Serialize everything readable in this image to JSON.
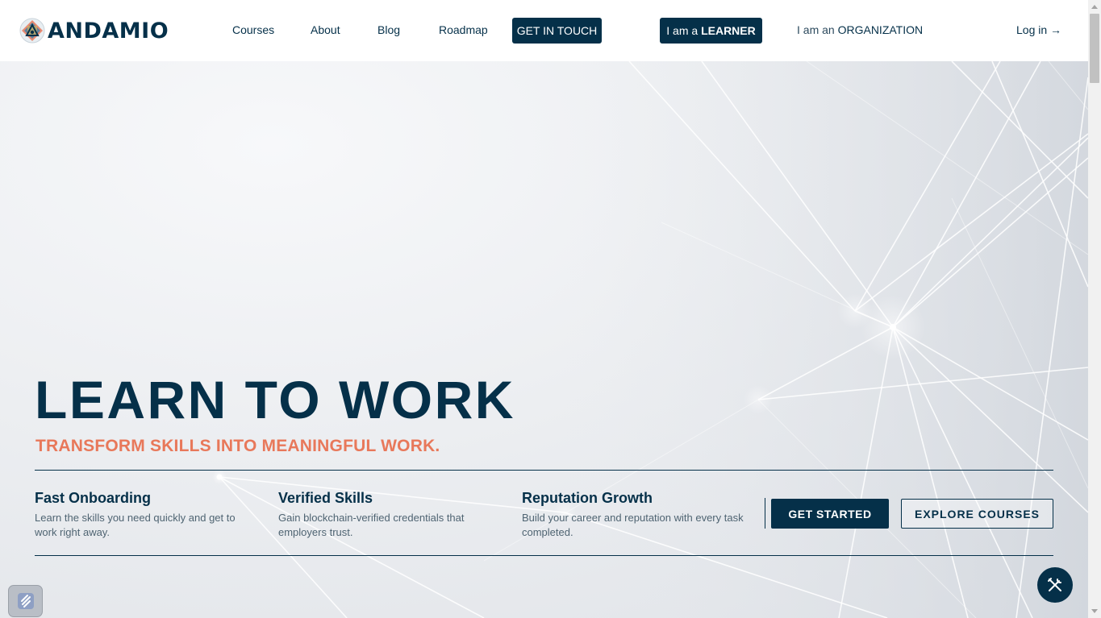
{
  "header": {
    "logo_text": "ANDAMIO",
    "nav": {
      "courses": "Courses",
      "about": "About",
      "blog": "Blog",
      "roadmap": "Roadmap"
    },
    "get_in_touch": "GET IN TOUCH",
    "learner_prefix": "I am a ",
    "learner_strong": "LEARNER",
    "org_prefix": "I am an ",
    "org_strong": "ORGANIZATION",
    "login": "Log in →"
  },
  "hero": {
    "title": "LEARN TO WORK",
    "subtitle": "TRANSFORM SKILLS INTO MEANINGFUL WORK.",
    "features": [
      {
        "title": "Fast Onboarding",
        "text": "Learn the skills you need quickly and get to work right away."
      },
      {
        "title": "Verified Skills",
        "text": "Gain blockchain-verified credentials that employers trust."
      },
      {
        "title": "Reputation Growth",
        "text": "Build your career and reputation with every task completed."
      }
    ],
    "get_started": "GET STARTED",
    "explore_courses": "EXPLORE COURSES"
  },
  "icons": {
    "fab": "tools-icon",
    "corner": "app-widget-icon",
    "logo": "andamio-logo-icon"
  },
  "colors": {
    "navy": "#053049",
    "accent": "#e8785a",
    "header_bg": "#ffffff",
    "hero_bg": "#eceef1"
  }
}
